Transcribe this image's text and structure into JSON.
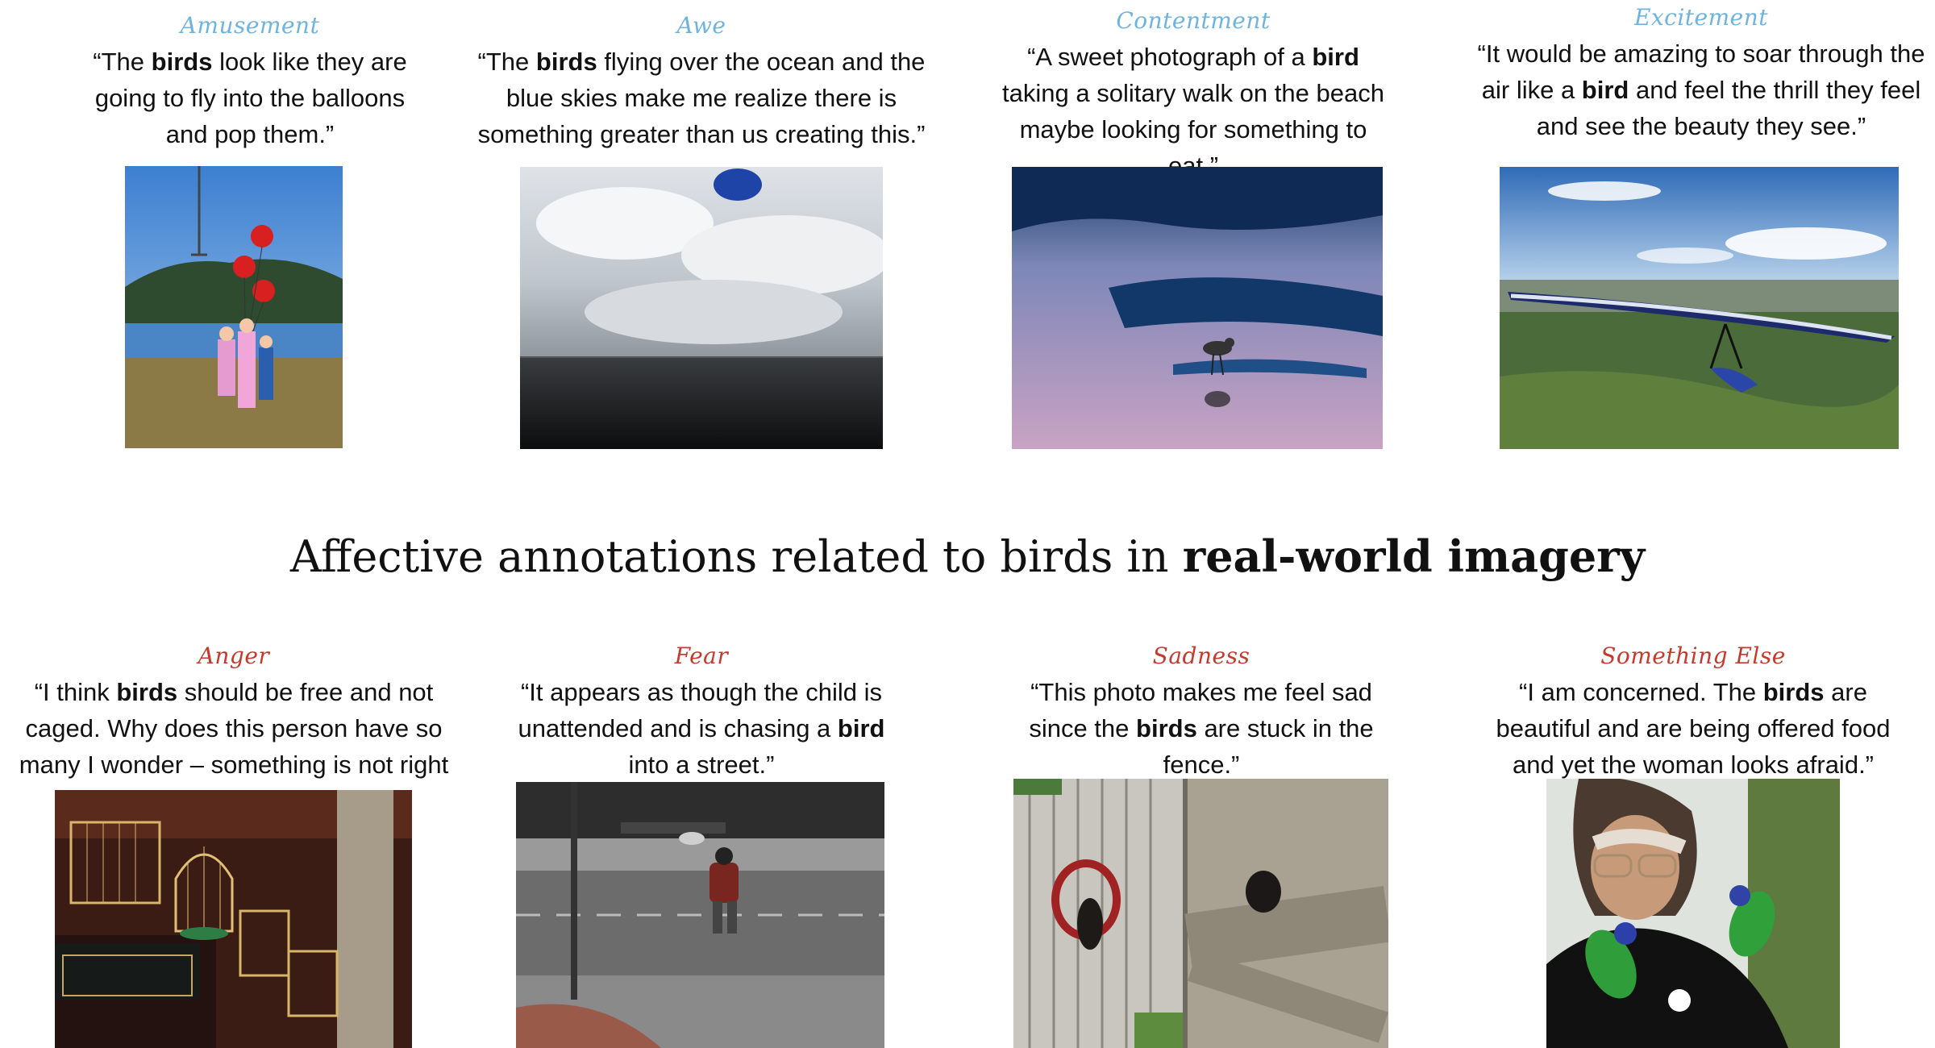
{
  "top_row": [
    {
      "emotion": "Amusement",
      "q1": "“The ",
      "bird": "birds",
      "q2": " look like they are going to fly into the balloons and pop them.”"
    },
    {
      "emotion": "Awe",
      "q1": "“The ",
      "bird": "birds",
      "q2": " flying over the ocean and the blue skies make me realize there is something greater than us creating this.”"
    },
    {
      "emotion": "Contentment",
      "q1": "“A sweet photograph of a ",
      "bird": "bird",
      "q2": " taking a solitary walk on the beach maybe looking for something to eat.”"
    },
    {
      "emotion": "Excitement",
      "q1": "“It would be amazing to soar through the air like a ",
      "bird": "bird",
      "q2": " and feel the thrill they feel and see the beauty they see.”"
    }
  ],
  "headline": {
    "plain": "Affective annotations related to birds in ",
    "bold": "real-world imagery"
  },
  "bottom_row": [
    {
      "emotion": "Anger",
      "q1": "“I think ",
      "bird": "birds",
      "q2": " should be free and not caged. Why does this person have so many I wonder – something is not right here.”"
    },
    {
      "emotion": "Fear",
      "q1": "“It appears as though the child is unattended and is chasing a ",
      "bird": "bird",
      "q2": " into a street.”"
    },
    {
      "emotion": "Sadness",
      "q1": "“This photo makes me feel sad since the ",
      "bird": "birds",
      "q2": " are stuck in the fence.”"
    },
    {
      "emotion": "Something Else",
      "q1": "“I am concerned. The ",
      "bird": "birds",
      "q2": " are beautiful and are being offered food and yet the woman looks afraid.”"
    }
  ],
  "colors": {
    "positive_emotion": "#6fb3e0",
    "negative_emotion": "#c43a2c"
  }
}
